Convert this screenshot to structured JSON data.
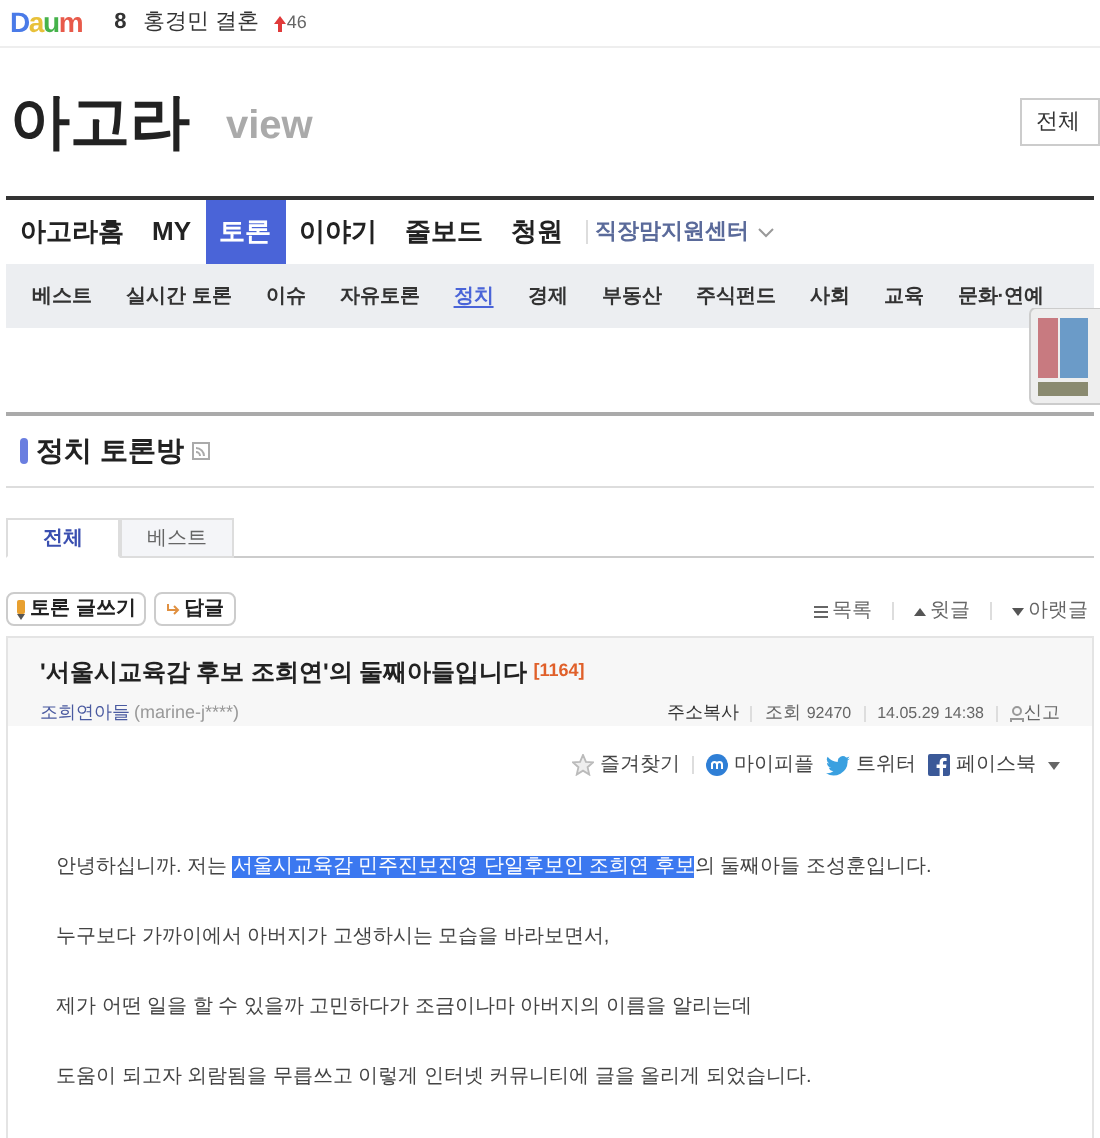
{
  "top_bar": {
    "logo": "Daum",
    "trend_rank": "8",
    "trend_keyword": "홍경민 결혼",
    "trend_change": "46"
  },
  "header": {
    "title": "아고라",
    "subtitle": "view",
    "scope_select": "전체"
  },
  "nav": [
    {
      "label": "아고라홈",
      "selected": false
    },
    {
      "label": "MY",
      "selected": false
    },
    {
      "label": "토론",
      "selected": true
    },
    {
      "label": "이야기",
      "selected": false
    },
    {
      "label": "줄보드",
      "selected": false
    },
    {
      "label": "청원",
      "selected": false
    }
  ],
  "nav_extra": "직장맘지원센터",
  "subnav": [
    {
      "label": "베스트",
      "selected": false
    },
    {
      "label": "실시간 토론",
      "selected": false
    },
    {
      "label": "이슈",
      "selected": false
    },
    {
      "label": "자유토론",
      "selected": false
    },
    {
      "label": "정치",
      "selected": true
    },
    {
      "label": "경제",
      "selected": false
    },
    {
      "label": "부동산",
      "selected": false
    },
    {
      "label": "주식펀드",
      "selected": false
    },
    {
      "label": "사회",
      "selected": false
    },
    {
      "label": "교육",
      "selected": false
    },
    {
      "label": "문화·연예",
      "selected": false
    }
  ],
  "board_title": "정치 토론방",
  "tabs": [
    {
      "label": "전체",
      "selected": true
    },
    {
      "label": "베스트",
      "selected": false
    }
  ],
  "actions": {
    "write": "토론 글쓰기",
    "reply": "답글",
    "list": "목록",
    "prev": "윗글",
    "next": "아랫글"
  },
  "post": {
    "title": "'서울시교육감 후보 조희연'의 둘째아들입니다",
    "comment_count": "[1164]",
    "author": "조희연아들",
    "author_id": "(marine-j****)",
    "copy_url": "주소복사",
    "views_label": "조회",
    "views": "92470",
    "date": "14.05.29 14:38",
    "report": "신고"
  },
  "share": [
    "즐겨찾기",
    "마이피플",
    "트위터",
    "페이스북"
  ],
  "paragraphs": [
    {
      "segments": [
        {
          "text": "안녕하십니까. 저는 ",
          "selected": false
        },
        {
          "text": "서울시교육감 민주진보진영 단일후보인 조희연 후보",
          "selected": true
        },
        {
          "text": "의 둘째아들 조성훈입니다.",
          "selected": false
        }
      ]
    },
    {
      "segments": [
        {
          "text": "누구보다 가까이에서 아버지가 고생하시는 모습을 바라보면서,",
          "selected": false
        }
      ]
    },
    {
      "segments": [
        {
          "text": "제가 어떤 일을 할 수 있을까 고민하다가 조금이나마 아버지의 이름을 알리는데",
          "selected": false
        }
      ]
    },
    {
      "segments": [
        {
          "text": "도움이 되고자 외람됨을 무릅쓰고 이렇게 인터넷 커뮤니티에 글을 올리게 되었습니다.",
          "selected": false
        }
      ]
    }
  ]
}
